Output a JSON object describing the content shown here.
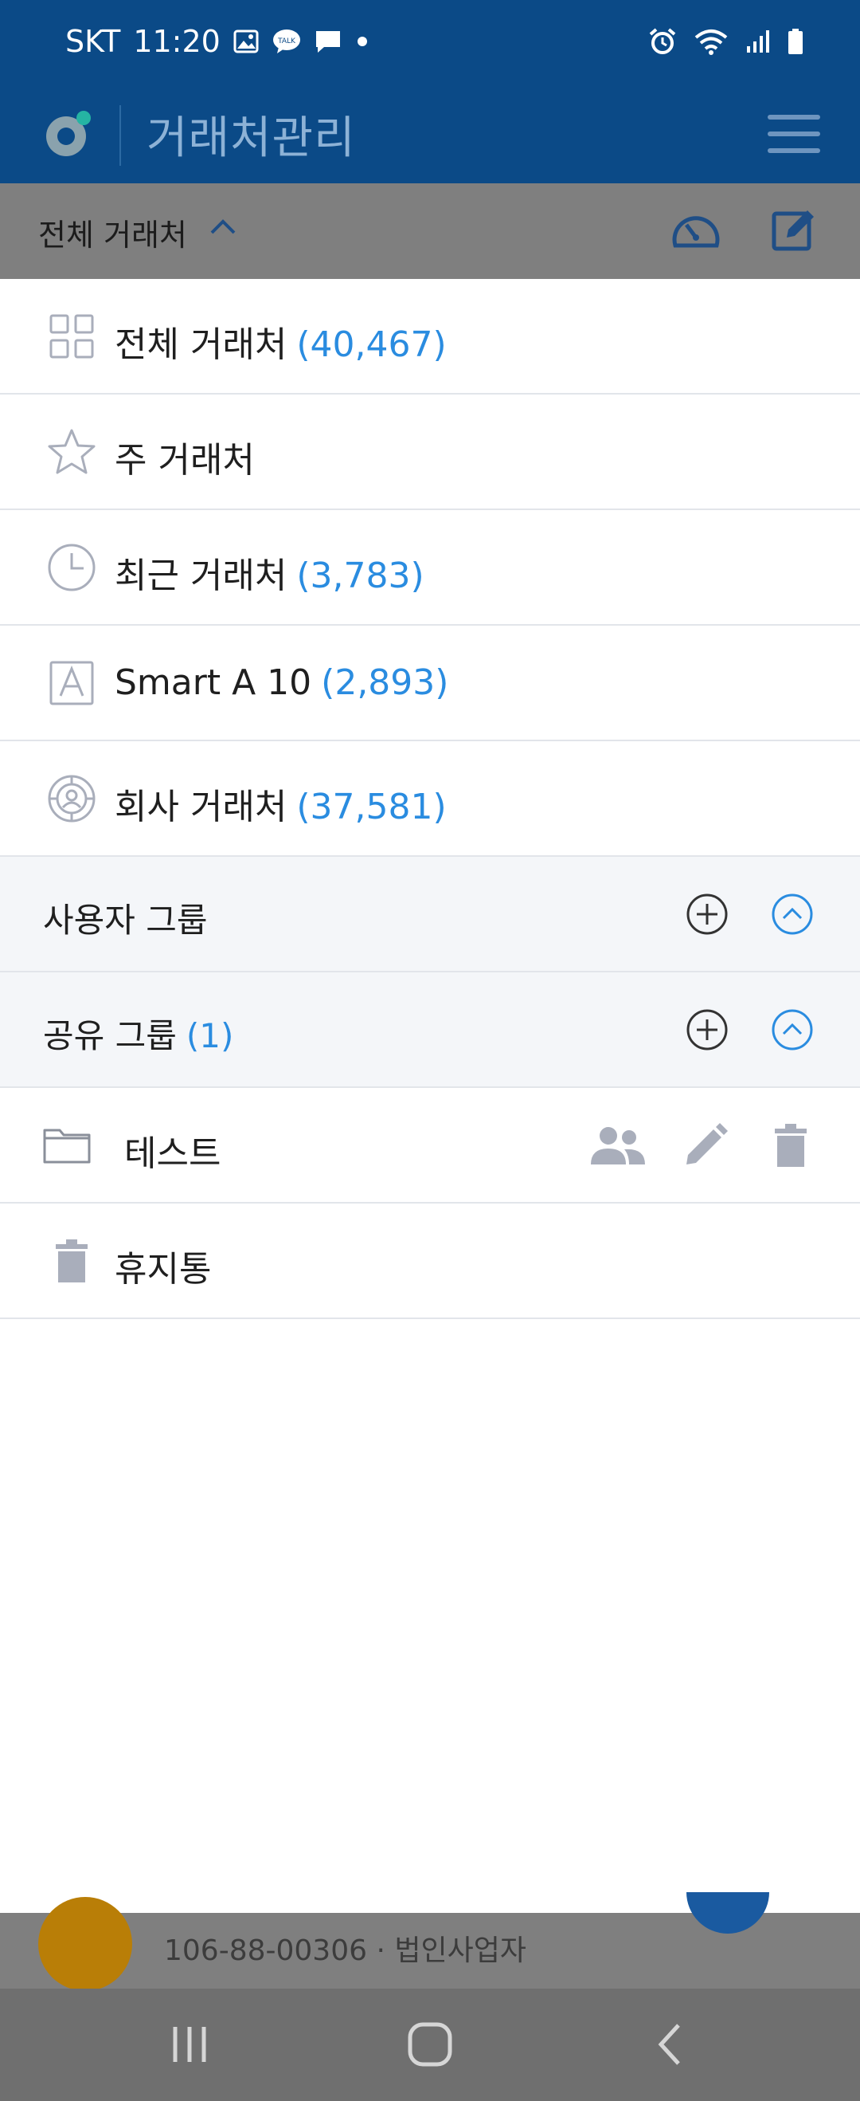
{
  "status_bar": {
    "carrier": "SKT",
    "time": "11:20",
    "left_icons": [
      "gallery-icon",
      "kakaotalk-icon",
      "message-icon",
      "dot-icon"
    ],
    "right_icons": [
      "alarm-icon",
      "wifi-icon",
      "signal-icon",
      "battery-icon"
    ]
  },
  "app_bar": {
    "title": "거래처관리",
    "menu_icon": "hamburger-menu-icon"
  },
  "filter_bar": {
    "label": "전체 거래처",
    "icons": [
      "chevron-up-icon",
      "speedometer-icon",
      "edit-icon"
    ]
  },
  "drawer": {
    "items": [
      {
        "icon": "grid-icon",
        "label": "전체 거래처",
        "count": "(40,467)"
      },
      {
        "icon": "star-icon",
        "label": "주 거래처",
        "count": ""
      },
      {
        "icon": "clock-icon",
        "label": "최근 거래처",
        "count": "(3,783)"
      },
      {
        "icon": "letter-a-icon",
        "label": "Smart A 10",
        "count": "(2,893)"
      },
      {
        "icon": "company-icon",
        "label": "회사 거래처",
        "count": "(37,581)"
      }
    ],
    "groups": [
      {
        "label": "사용자 그룹",
        "count": "",
        "add_icon": "add-circle-icon",
        "toggle_icon": "chevron-up-circle-icon"
      },
      {
        "label": "공유 그룹",
        "count": "(1)",
        "add_icon": "add-circle-icon",
        "toggle_icon": "chevron-up-circle-icon"
      }
    ],
    "shared_folder": {
      "icon": "folder-icon",
      "label": "테스트",
      "actions": [
        "people-icon",
        "pencil-icon",
        "trash-icon"
      ]
    },
    "trash": {
      "icon": "trash-icon",
      "label": "휴지통"
    }
  },
  "underlying_list": {
    "partial_item_text": "106-88-00306 · 법인사업자"
  },
  "nav_bar": {
    "buttons": [
      "recents-icon",
      "home-icon",
      "back-icon"
    ]
  },
  "colors": {
    "header": "#0b4a87",
    "accent": "#2a8ce0",
    "count_text": "#2a8ce0",
    "icon_gray": "#a9aebb"
  }
}
